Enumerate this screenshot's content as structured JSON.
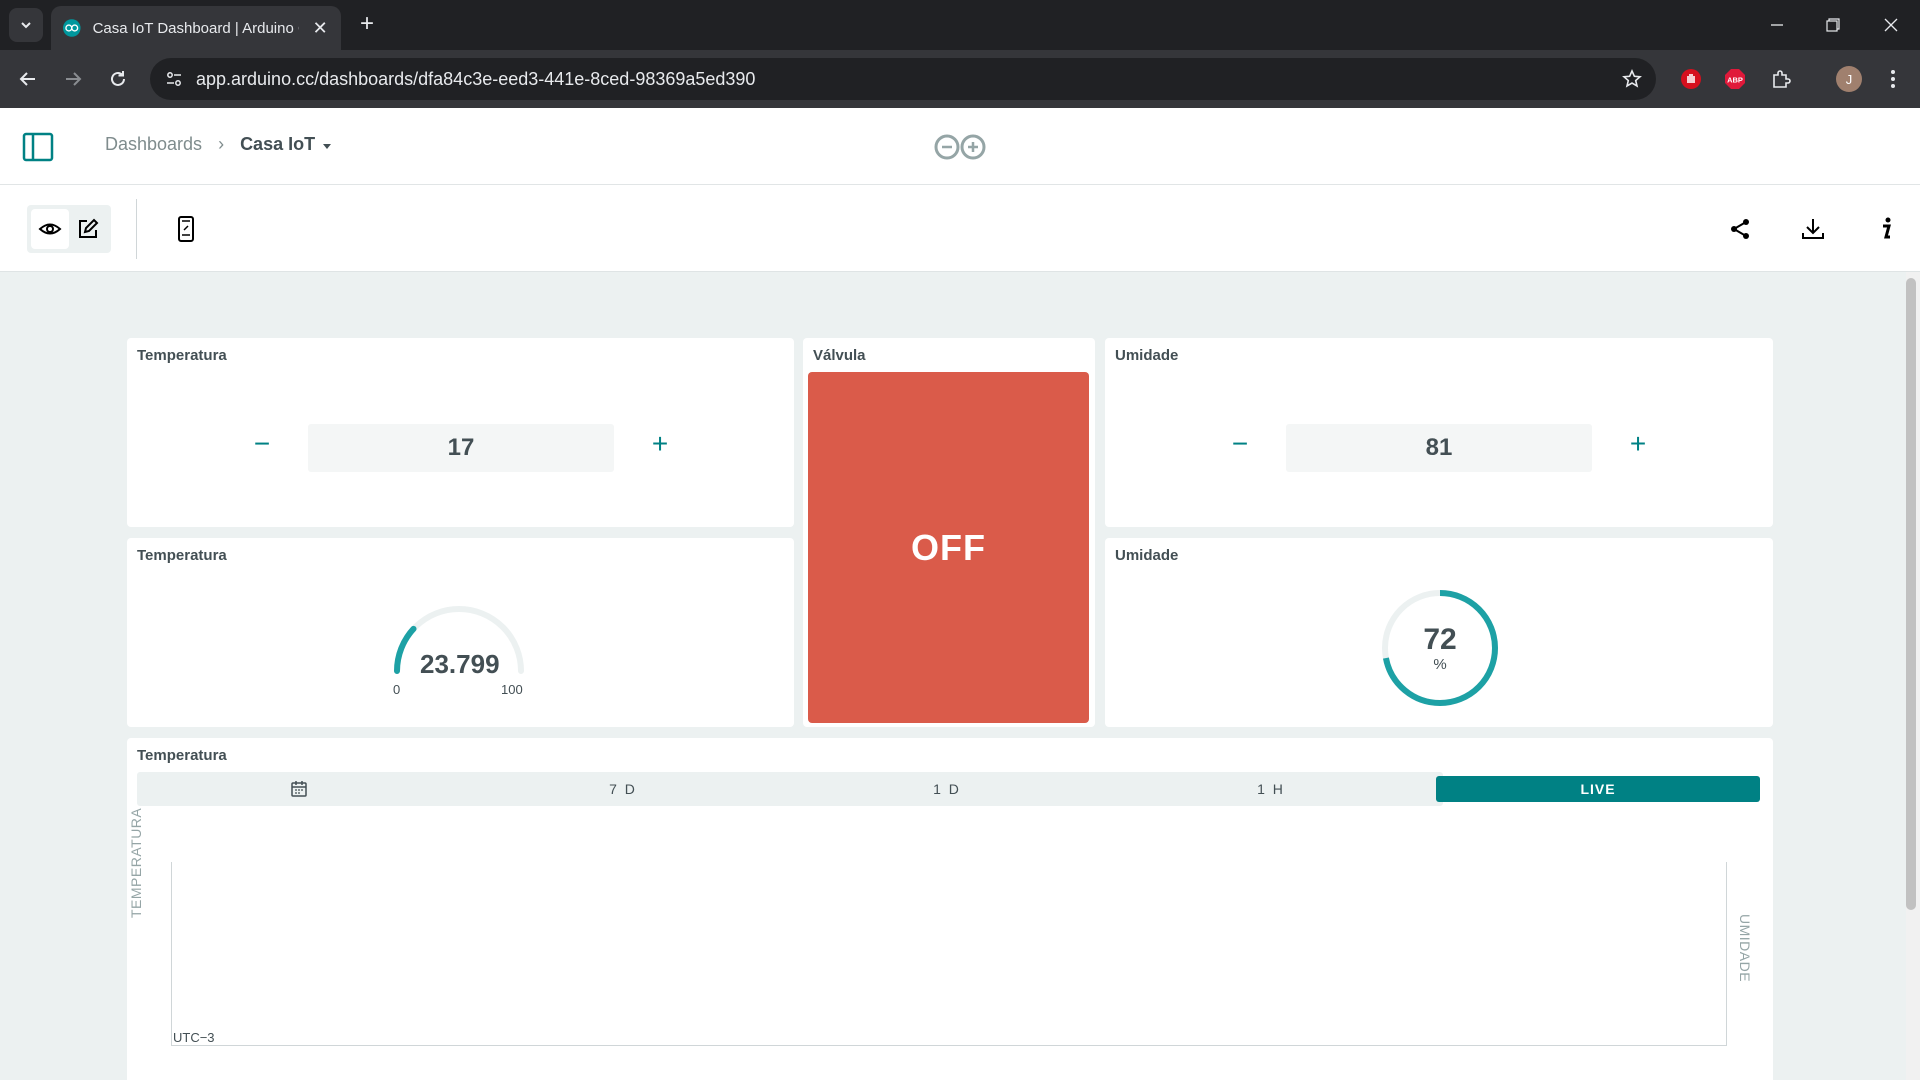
{
  "browser": {
    "tab_title": "Casa IoT Dashboard | Arduino C",
    "url": "app.arduino.cc/dashboards/dfa84c3e-eed3-441e-8ced-98369a5ed390",
    "avatar_initial": "J",
    "abp_label": "ABP"
  },
  "header": {
    "breadcrumb_root": "Dashboards",
    "breadcrumb_separator": "›",
    "breadcrumb_current": "Casa IoT"
  },
  "widgets": {
    "temp_stepper": {
      "title": "Temperatura",
      "value": "17",
      "minus": "−",
      "plus": "+"
    },
    "valve_switch": {
      "title": "Válvula",
      "state": "OFF"
    },
    "humidity_stepper": {
      "title": "Umidade",
      "value": "81",
      "minus": "−",
      "plus": "+"
    },
    "temp_gauge": {
      "title": "Temperatura",
      "value": "23.799",
      "min": "0",
      "max": "100",
      "fill_fraction": 0.238
    },
    "humidity_percent": {
      "title": "Umidade",
      "value": "72",
      "unit": "%",
      "fill_fraction": 0.72
    },
    "chart": {
      "title": "Temperatura",
      "ranges": [
        "7 D",
        "1 D",
        "1 H"
      ],
      "live_label": "LIVE",
      "left_axis": "TEMPERATURA",
      "right_axis": "UMIDADE",
      "timezone": "UTC−3"
    }
  },
  "colors": {
    "accent": "#008184",
    "switch_off": "#da5b4a",
    "canvas_bg": "#ecf1f1",
    "text": "#434f54"
  }
}
